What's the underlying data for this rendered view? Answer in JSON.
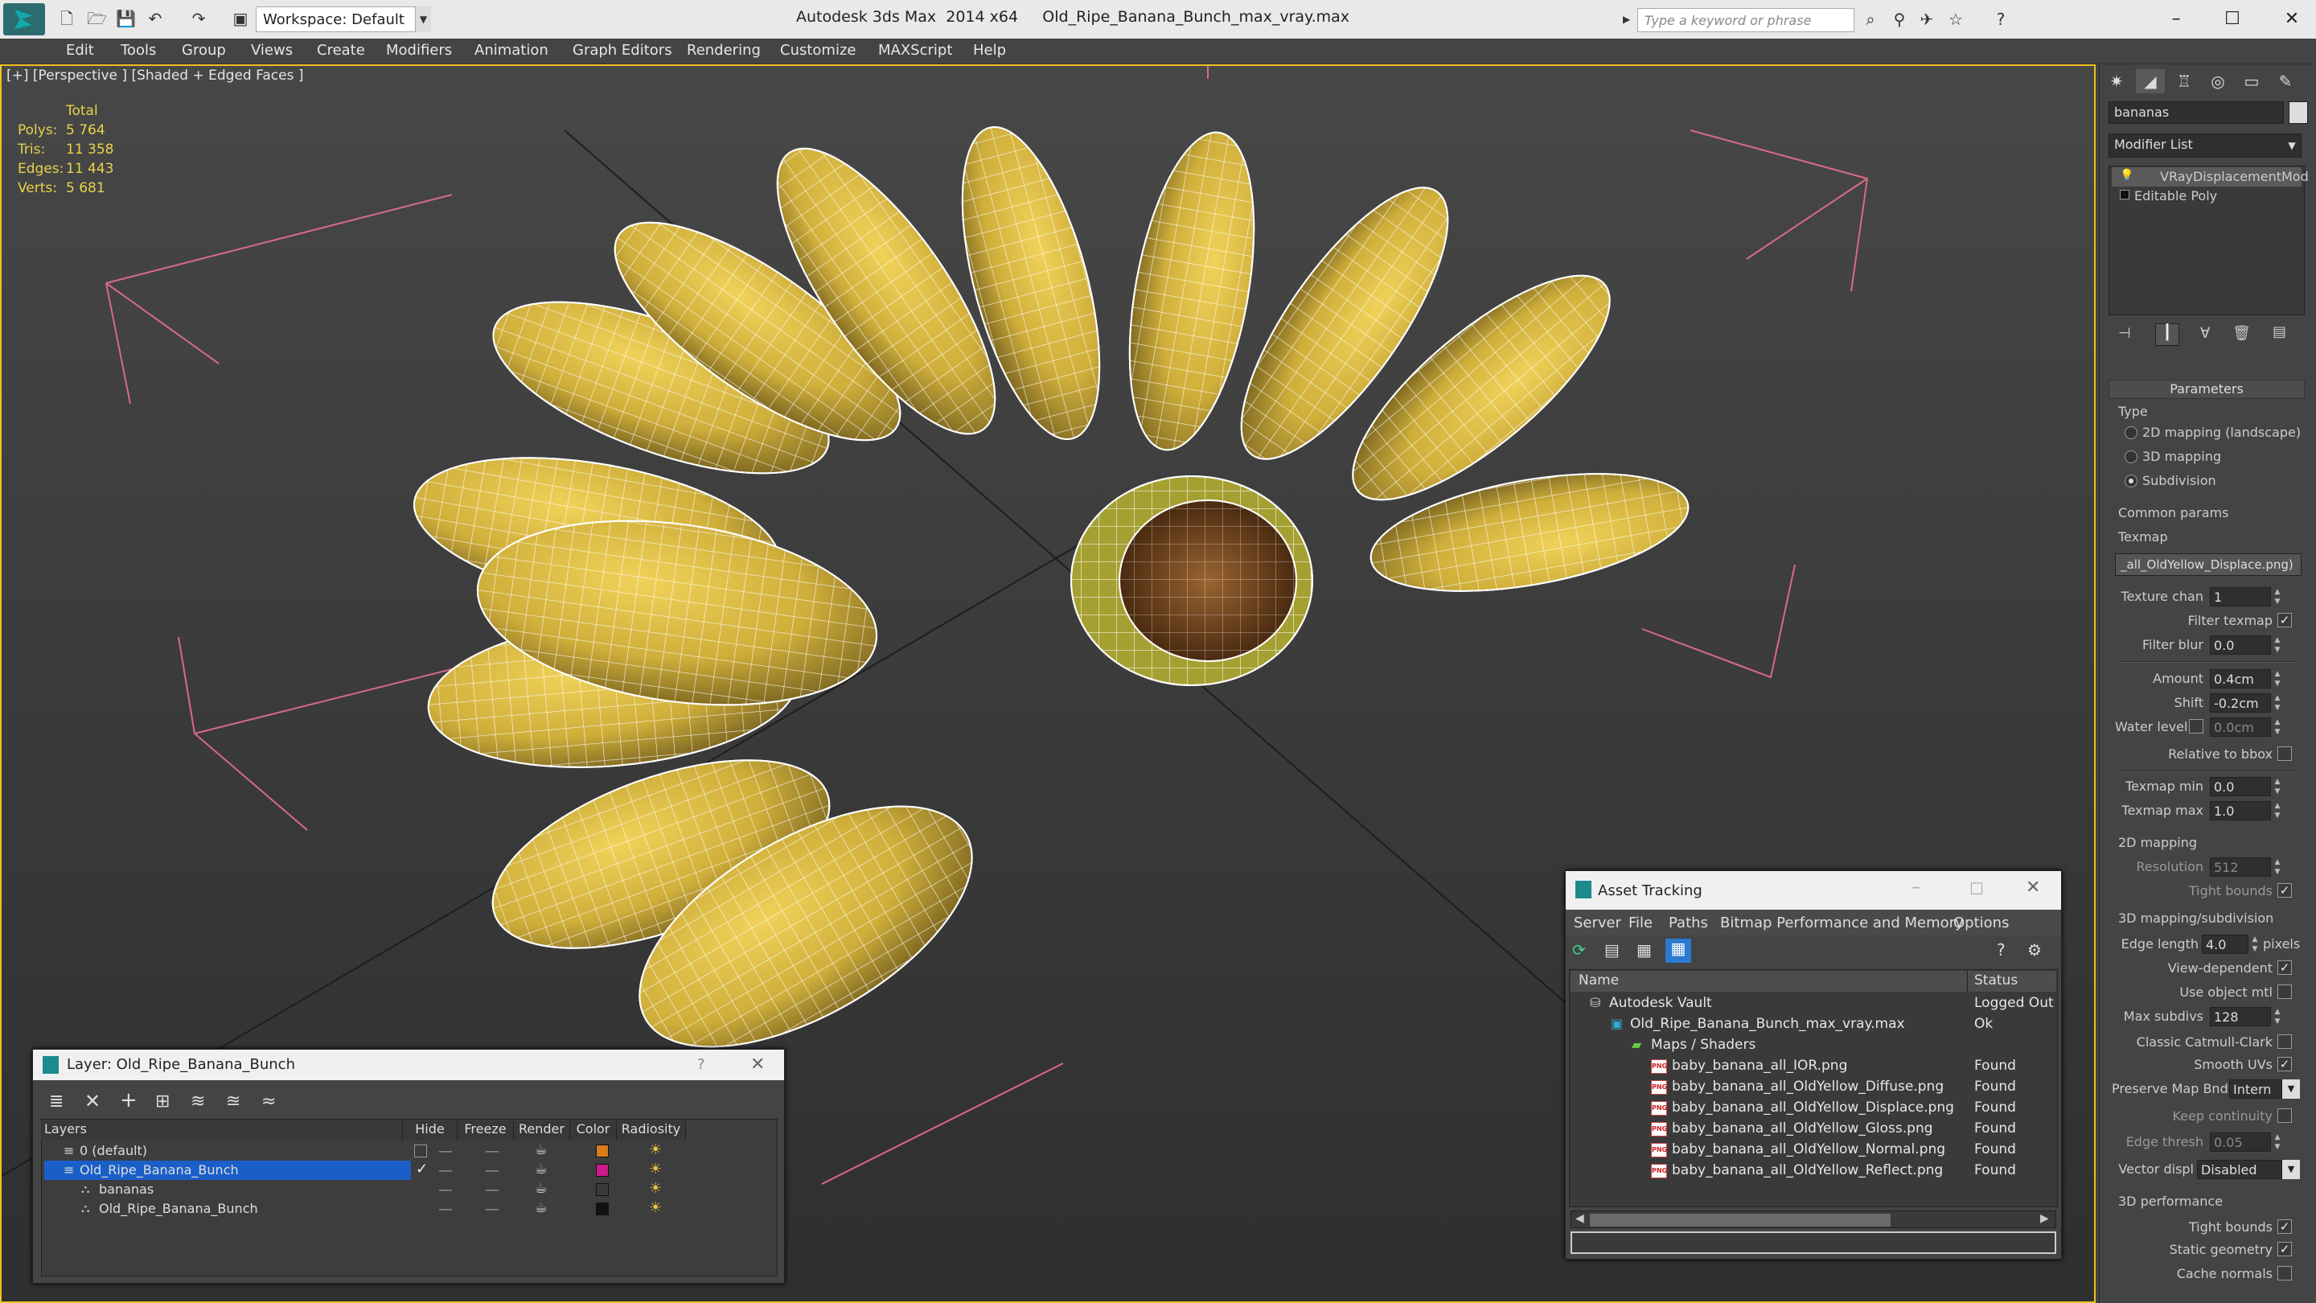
{
  "titlebar": {
    "app_title": "Autodesk 3ds Max  2014 x64",
    "file_title": "Old_Ripe_Banana_Bunch_max_vray.max",
    "workspace": "Workspace: Default",
    "search_placeholder": "Type a keyword or phrase"
  },
  "menu": [
    "Edit",
    "Tools",
    "Group",
    "Views",
    "Create",
    "Modifiers",
    "Animation",
    "Graph Editors",
    "Rendering",
    "Customize",
    "MAXScript",
    "Help"
  ],
  "viewport": {
    "label": "[+] [Perspective ] [Shaded + Edged Faces ]",
    "stats": {
      "header": "Total",
      "rows": [
        {
          "label": "Polys:",
          "value": "5 764"
        },
        {
          "label": "Tris:",
          "value": "11 358"
        },
        {
          "label": "Edges:",
          "value": "11 443"
        },
        {
          "label": "Verts:",
          "value": "5 681"
        }
      ]
    }
  },
  "command_panel": {
    "object_name": "bananas",
    "modifier_list": "Modifier List",
    "stack": [
      "VRayDisplacementMod",
      "Editable Poly"
    ],
    "parameters_title": "Parameters",
    "type_label": "Type",
    "type_options": [
      "2D mapping (landscape)",
      "3D mapping",
      "Subdivision"
    ],
    "common_params": "Common params",
    "texmap_label": "Texmap",
    "texmap_value": "_all_OldYellow_Displace.png)",
    "texture_chan": {
      "label": "Texture chan",
      "value": "1"
    },
    "filter_texmap": "Filter texmap",
    "filter_blur": {
      "label": "Filter blur",
      "value": "0.0"
    },
    "amount": {
      "label": "Amount",
      "value": "0.4cm"
    },
    "shift": {
      "label": "Shift",
      "value": "-0.2cm"
    },
    "water_level": {
      "label": "Water level",
      "value": "0.0cm"
    },
    "relative_bbox": "Relative to bbox",
    "texmap_min": {
      "label": "Texmap min",
      "value": "0.0"
    },
    "texmap_max": {
      "label": "Texmap max",
      "value": "1.0"
    },
    "mapping2d": "2D mapping",
    "resolution": {
      "label": "Resolution",
      "value": "512"
    },
    "tight_bounds": "Tight bounds",
    "mapping3d": "3D mapping/subdivision",
    "edge_length": {
      "label": "Edge length",
      "value": "4.0",
      "unit": "pixels"
    },
    "view_dependent": "View-dependent",
    "use_object_mtl": "Use object mtl",
    "max_subdivs": {
      "label": "Max subdivs",
      "value": "128"
    },
    "classic_catmull": "Classic Catmull-Clark",
    "smooth_uvs": "Smooth UVs",
    "preserve_map_bnd": {
      "label": "Preserve Map Bnd",
      "value": "Intern"
    },
    "keep_continuity": "Keep continuity",
    "edge_thresh": {
      "label": "Edge thresh",
      "value": "0.05"
    },
    "vector_displ": {
      "label": "Vector displ",
      "value": "Disabled"
    },
    "perf3d": "3D performance",
    "tight_bounds2": "Tight bounds",
    "static_geometry": "Static geometry",
    "cache_normals": "Cache normals"
  },
  "layer_window": {
    "title": "Layer: Old_Ripe_Banana_Bunch",
    "help": "?",
    "columns": [
      "Layers",
      "Hide",
      "Freeze",
      "Render",
      "Color",
      "Radiosity"
    ],
    "rows": [
      {
        "name": "0 (default)",
        "color": "#d87a1e"
      },
      {
        "name": "Old_Ripe_Banana_Bunch",
        "color": "#cc1a8a"
      },
      {
        "name": "bananas",
        "color": "#3a3a3a"
      },
      {
        "name": "Old_Ripe_Banana_Bunch",
        "color": "#111111"
      }
    ]
  },
  "asset_window": {
    "title": "Asset Tracking",
    "menu": [
      "Server",
      "File",
      "Paths",
      "Bitmap Performance and Memory",
      "Options"
    ],
    "columns": [
      "Name",
      "Status"
    ],
    "rows": [
      {
        "name": "Autodesk Vault",
        "status": "Logged Out"
      },
      {
        "name": "Old_Ripe_Banana_Bunch_max_vray.max",
        "status": "Ok"
      },
      {
        "name": "Maps / Shaders",
        "status": ""
      },
      {
        "name": "baby_banana_all_IOR.png",
        "status": "Found"
      },
      {
        "name": "baby_banana_all_OldYellow_Diffuse.png",
        "status": "Found"
      },
      {
        "name": "baby_banana_all_OldYellow_Displace.png",
        "status": "Found"
      },
      {
        "name": "baby_banana_all_OldYellow_Gloss.png",
        "status": "Found"
      },
      {
        "name": "baby_banana_all_OldYellow_Normal.png",
        "status": "Found"
      },
      {
        "name": "baby_banana_all_OldYellow_Reflect.png",
        "status": "Found"
      }
    ]
  },
  "colors": {
    "viewport_border": "#f0c020",
    "selection": "#1a5fc8",
    "banana": "#d6b640",
    "stats": "#e8d24a"
  }
}
